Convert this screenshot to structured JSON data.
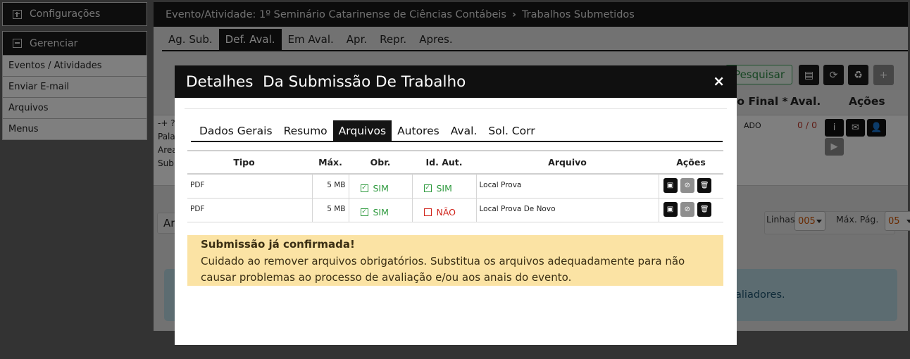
{
  "sidebar": {
    "config_label": "Configurações",
    "manage_label": "Gerenciar",
    "items": [
      {
        "label": "Eventos / Atividades"
      },
      {
        "label": "Enviar E-mail"
      },
      {
        "label": "Arquivos"
      },
      {
        "label": "Menus"
      }
    ]
  },
  "header": {
    "event": "Evento/Atividade: 1º Seminário Catarinense de Ciências Contábeis",
    "page": "Trabalhos Submetidos"
  },
  "tabs": [
    "Ag. Sub.",
    "Def. Aval.",
    "Em Aval.",
    "Apr.",
    "Repr.",
    "Apres."
  ],
  "toolbar": {
    "search_label": "Pesquisar"
  },
  "table": {
    "col_final": "to Final *",
    "col_aval": "Aval.",
    "col_acoes": "Ações",
    "row": {
      "left_lines": [
        "-+ ?",
        "Pala",
        "Area",
        "Sub"
      ],
      "status": "ADO",
      "score": "0 / 0"
    }
  },
  "pagination": {
    "ar": "Ar",
    "rows_label": "Linhas",
    "rows_value": "005",
    "max_label": "Máx. Pág.",
    "max_value": "05"
  },
  "info_partial": "aliadores.",
  "modal": {
    "title": "Detalhes  Da Submissão De Trabalho",
    "close": "×",
    "tabs": [
      "Dados Gerais",
      "Resumo",
      "Arquivos",
      "Autores",
      "Aval.",
      "Sol. Corr"
    ],
    "active_tab": "Arquivos",
    "headers": {
      "tipo": "Tipo",
      "max": "Máx.",
      "obr": "Obr.",
      "id_aut": "Id. Aut.",
      "arquivo": "Arquivo",
      "acoes": "Ações"
    },
    "rows": [
      {
        "tipo": "PDF",
        "max": "5 MB",
        "obr": "SIM",
        "id_aut": "SIM",
        "arquivo": "Local Prova"
      },
      {
        "tipo": "PDF",
        "max": "5 MB",
        "obr": "SIM",
        "id_aut": "NÃO",
        "arquivo": "Local Prova De Novo"
      }
    ],
    "warning": {
      "title": "Submissão já confirmada!",
      "text": "Cuidado ao remover arquivos obrigatórios. Substitua os arquivos adequadamente para não causar problemas ao processo de avaliação e/ou aos anais do evento."
    }
  },
  "colors": {
    "accent_green": "#2e9a3e",
    "danger_red": "#d0241b",
    "warning_bg": "#fbe3a4",
    "header_dark": "#101010"
  }
}
